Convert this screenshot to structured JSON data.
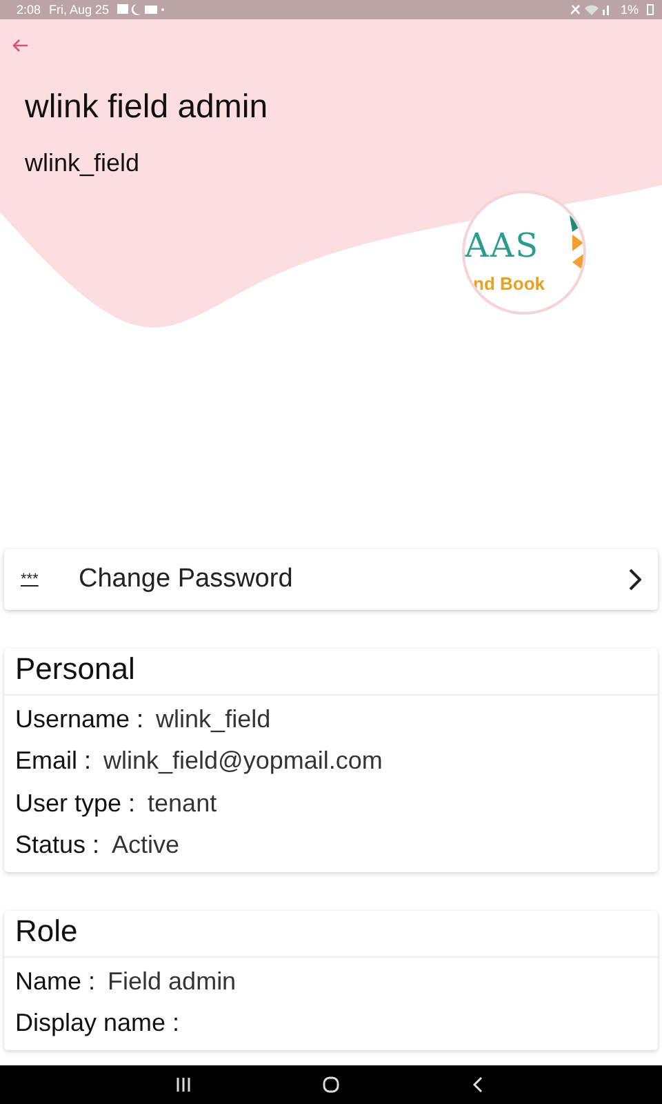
{
  "status_bar": {
    "time": "2:08",
    "date": "Fri, Aug 25",
    "battery": "1%"
  },
  "header": {
    "title": "wlink field admin",
    "subtitle": "wlink_field",
    "logo": {
      "line_1": "AAS",
      "line_2": "nd Book"
    }
  },
  "change_password": {
    "icon": "***",
    "label": "Change Password"
  },
  "sections": [
    {
      "title": "Personal",
      "fields": [
        {
          "label": "Username :",
          "value": "wlink_field"
        },
        {
          "label": "Email :",
          "value": "wlink_field@yopmail.com"
        },
        {
          "label": "User type :",
          "value": "tenant"
        },
        {
          "label": "Status :",
          "value": "Active"
        }
      ]
    },
    {
      "title": "Role",
      "fields": [
        {
          "label": "Name :",
          "value": "Field admin"
        },
        {
          "label": "Display name :"
        }
      ]
    }
  ]
}
